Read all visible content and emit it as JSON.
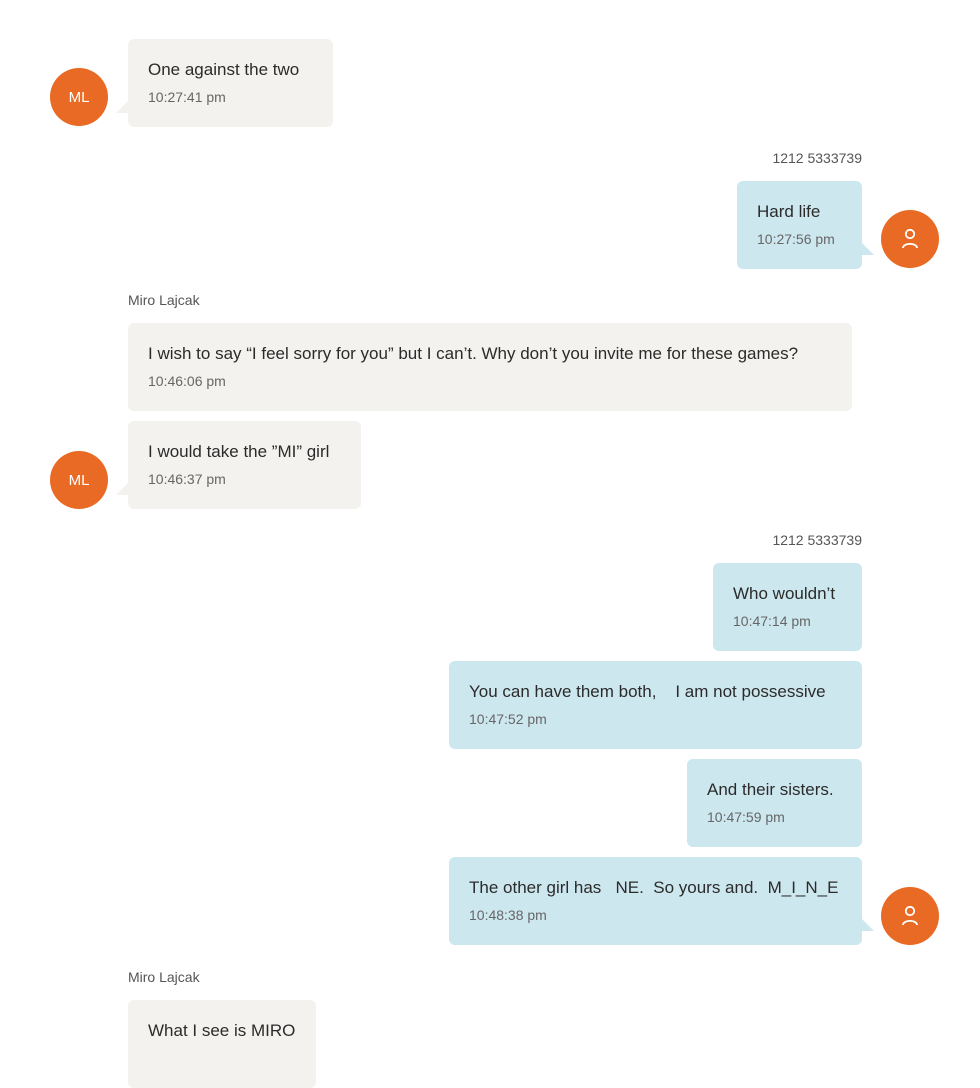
{
  "colors": {
    "avatar": "#e86a24",
    "incoming_bubble": "#f3f2ef",
    "outgoing_bubble": "#cde7ef"
  },
  "contacts": {
    "them_initials": "ML",
    "them_name": "Miro Lajcak",
    "me_number": "1212 5333739",
    "me_avatar_icon": "person-icon"
  },
  "messages": [
    {
      "text": "One against the two",
      "time": "10:27:41 pm"
    },
    {
      "text": "Hard life",
      "time": "10:27:56 pm"
    },
    {
      "text": "I wish to say “I feel sorry for you” but I can’t. Why don’t you invite me for these games?",
      "time": "10:46:06 pm"
    },
    {
      "text": "I would take the ”MI” girl",
      "time": "10:46:37 pm"
    },
    {
      "text": "Who wouldn’t",
      "time": "10:47:14 pm"
    },
    {
      "text": "You can have them both,    I am not possessive",
      "time": "10:47:52 pm"
    },
    {
      "text": "And their sisters.",
      "time": "10:47:59 pm"
    },
    {
      "text": "The other girl has   NE.  So yours and.  M_I_N_E",
      "time": "10:48:38 pm"
    },
    {
      "text": "What I see is MIRO",
      "time": ""
    }
  ]
}
